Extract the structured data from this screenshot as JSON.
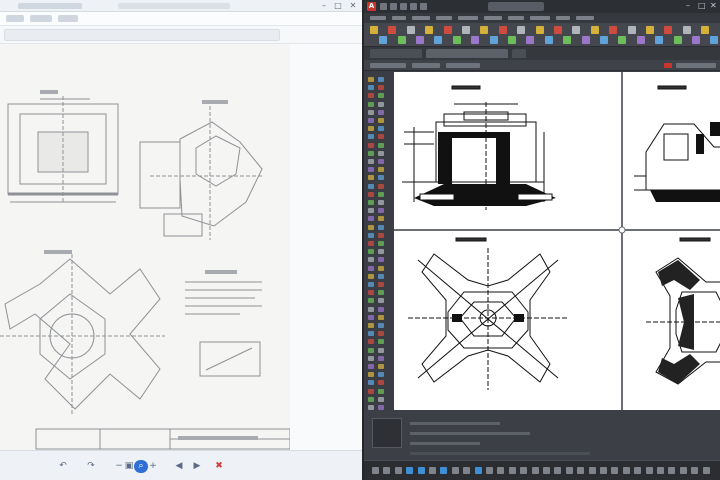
{
  "viewer": {
    "title": "",
    "controls": {
      "minimize": "–",
      "maximize": "□",
      "close": "✕"
    },
    "bottom_buttons": [
      {
        "icon": "rotate-left-icon",
        "glyph": "↶"
      },
      {
        "icon": "rotate-right-icon",
        "glyph": "↷"
      },
      {
        "icon": "zoom-out-icon",
        "glyph": "−"
      },
      {
        "icon": "fit-icon",
        "glyph": "▣"
      },
      {
        "icon": "actual-size-icon",
        "glyph": "⌕"
      },
      {
        "icon": "zoom-in-icon",
        "glyph": "+"
      },
      {
        "icon": "previous-icon",
        "glyph": "◀"
      },
      {
        "icon": "next-icon",
        "glyph": "▶"
      },
      {
        "icon": "delete-icon",
        "glyph": "✖"
      }
    ],
    "active_button_index": 4
  },
  "cad": {
    "app_letter": "A",
    "controls": {
      "minimize": "–",
      "maximize": "□",
      "close": "✕"
    },
    "colors": {
      "background": "#3b3e44",
      "accent": "#c8372f",
      "status_on": "#3d8fd8",
      "ribbon_icon_palette": [
        "#d6b13a",
        "#5fa3d9",
        "#cf4b3f",
        "#6dbd5a",
        "#b0b5bc",
        "#9b77c9"
      ]
    }
  }
}
